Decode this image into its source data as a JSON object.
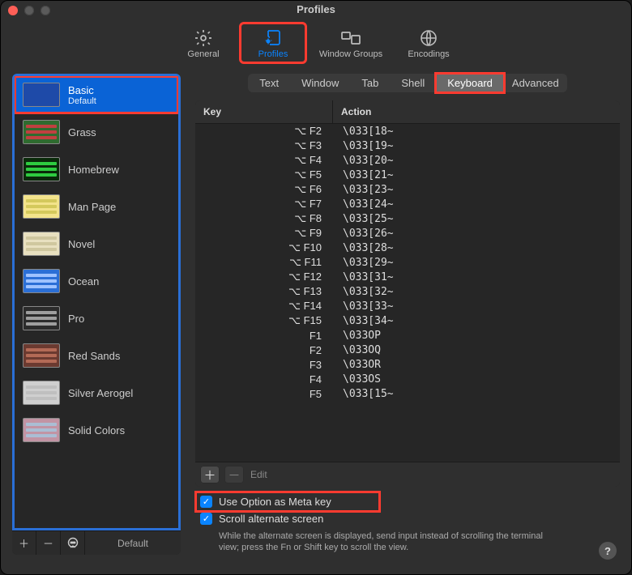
{
  "window": {
    "title": "Profiles"
  },
  "toolbar": {
    "general": {
      "label": "General",
      "active": false
    },
    "profiles": {
      "label": "Profiles",
      "active": true
    },
    "groups": {
      "label": "Window Groups",
      "active": false
    },
    "encodings": {
      "label": "Encodings",
      "active": false
    }
  },
  "sidebar": {
    "items": [
      {
        "name": "Basic",
        "subtitle": "Default",
        "selected": true,
        "colors": [
          "#1e4aa8",
          "#1e4aa8"
        ]
      },
      {
        "name": "Grass",
        "colors": [
          "#2f6b2f",
          "#c04040"
        ]
      },
      {
        "name": "Homebrew",
        "colors": [
          "#0a2a0a",
          "#2ecc40"
        ]
      },
      {
        "name": "Man Page",
        "colors": [
          "#f3e38b",
          "#d4c95c"
        ]
      },
      {
        "name": "Novel",
        "colors": [
          "#e8e0c0",
          "#cfc79f"
        ]
      },
      {
        "name": "Ocean",
        "colors": [
          "#2b6fd6",
          "#9ec2ff"
        ]
      },
      {
        "name": "Pro",
        "colors": [
          "#2b2b2b",
          "#9e9e9e"
        ]
      },
      {
        "name": "Red Sands",
        "colors": [
          "#6b3a30",
          "#b36a56"
        ]
      },
      {
        "name": "Silver Aerogel",
        "colors": [
          "#cfcfcf",
          "#bfbfbf"
        ]
      },
      {
        "name": "Solid Colors",
        "colors": [
          "#c294a4",
          "#aabed4"
        ]
      }
    ],
    "footer": {
      "default_label": "Default"
    }
  },
  "tabs": {
    "items": [
      {
        "label": "Text"
      },
      {
        "label": "Window"
      },
      {
        "label": "Tab"
      },
      {
        "label": "Shell"
      },
      {
        "label": "Keyboard",
        "active": true
      },
      {
        "label": "Advanced"
      }
    ]
  },
  "table": {
    "headers": {
      "key": "Key",
      "action": "Action"
    },
    "rows": [
      {
        "key": "⌥ F2",
        "action": "\\033[18~"
      },
      {
        "key": "⌥ F3",
        "action": "\\033[19~"
      },
      {
        "key": "⌥ F4",
        "action": "\\033[20~"
      },
      {
        "key": "⌥ F5",
        "action": "\\033[21~"
      },
      {
        "key": "⌥ F6",
        "action": "\\033[23~"
      },
      {
        "key": "⌥ F7",
        "action": "\\033[24~"
      },
      {
        "key": "⌥ F8",
        "action": "\\033[25~"
      },
      {
        "key": "⌥ F9",
        "action": "\\033[26~"
      },
      {
        "key": "⌥ F10",
        "action": "\\033[28~"
      },
      {
        "key": "⌥ F11",
        "action": "\\033[29~"
      },
      {
        "key": "⌥ F12",
        "action": "\\033[31~"
      },
      {
        "key": "⌥ F13",
        "action": "\\033[32~"
      },
      {
        "key": "⌥ F14",
        "action": "\\033[33~"
      },
      {
        "key": "⌥ F15",
        "action": "\\033[34~"
      },
      {
        "key": "F1",
        "action": "\\033OP"
      },
      {
        "key": "F2",
        "action": "\\033OQ"
      },
      {
        "key": "F3",
        "action": "\\033OR"
      },
      {
        "key": "F4",
        "action": "\\033OS"
      },
      {
        "key": "F5",
        "action": "\\033[15~"
      }
    ],
    "footer": {
      "edit_label": "Edit"
    }
  },
  "options": {
    "meta": {
      "label": "Use Option as Meta key",
      "checked": true
    },
    "scroll": {
      "label": "Scroll alternate screen",
      "checked": true
    },
    "hint": "While the alternate screen is displayed, send input instead of scrolling the terminal view; press the Fn or Shift key to scroll the view."
  }
}
